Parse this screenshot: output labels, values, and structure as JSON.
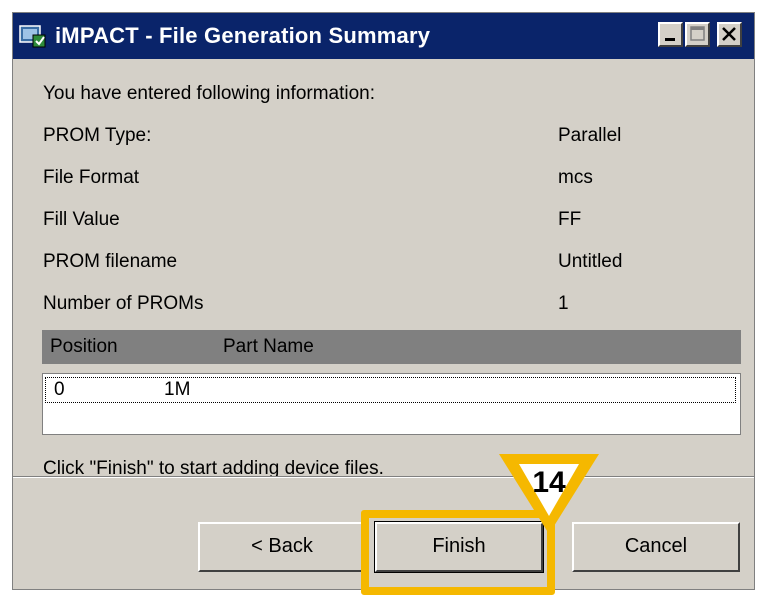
{
  "window": {
    "title": "iMPACT - File Generation Summary"
  },
  "summary": {
    "intro": "You have entered following information:",
    "rows": [
      {
        "label": "PROM Type:",
        "value": "Parallel"
      },
      {
        "label": "File Format",
        "value": "mcs"
      },
      {
        "label": "Fill Value",
        "value": "FF"
      },
      {
        "label": "PROM filename",
        "value": "Untitled"
      },
      {
        "label": "Number of PROMs",
        "value": "1"
      }
    ]
  },
  "table": {
    "headers": [
      "Position",
      "Part Name"
    ],
    "rows": [
      [
        "0",
        "1M"
      ]
    ]
  },
  "hint": "Click \"Finish\" to start adding device files.",
  "buttons": {
    "back": "< Back",
    "finish": "Finish",
    "cancel": "Cancel"
  },
  "callout": {
    "number": "14",
    "color": "#f5b800"
  }
}
